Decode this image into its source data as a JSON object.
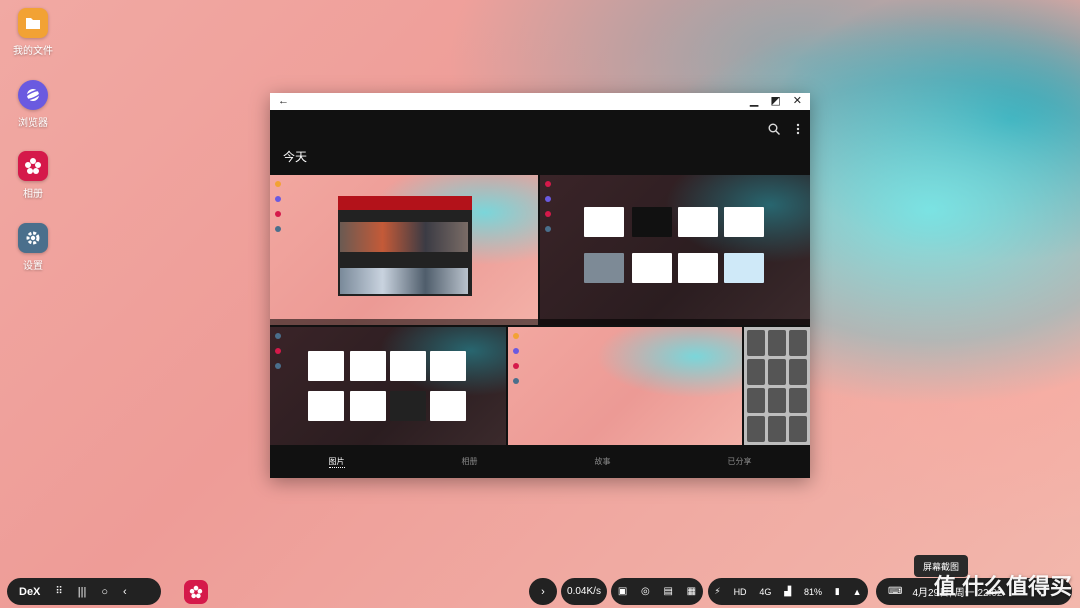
{
  "desktop": {
    "icons": [
      {
        "label": "我的文件",
        "icon": "folder-icon",
        "color": "#f2a234"
      },
      {
        "label": "浏览器",
        "icon": "internet-browser-icon",
        "color": "#6a5ae0"
      },
      {
        "label": "相册",
        "icon": "gallery-flower-icon",
        "color": "#d5194a"
      },
      {
        "label": "设置",
        "icon": "gear-icon",
        "color": "#4a6f8c"
      }
    ]
  },
  "window": {
    "back": "←",
    "minimize": "▁",
    "maximize": "◩",
    "close": "✕",
    "section_title": "今天",
    "tabs": [
      "图片",
      "相册",
      "故事",
      "已分享"
    ],
    "active_tab": "图片"
  },
  "taskbar": {
    "dex_label": "DeX",
    "network_speed": "0.04K/s",
    "battery": "81%",
    "hd": "HD",
    "signal_4g": "4G",
    "datetime": "4月29日, 周一 22:02",
    "screenshot_popup": "屏幕截图"
  },
  "watermark": "值 什么值得买",
  "colors": {
    "accent_gallery": "#d5194a",
    "taskbar_bg": "#222222",
    "window_bg": "#111111"
  }
}
